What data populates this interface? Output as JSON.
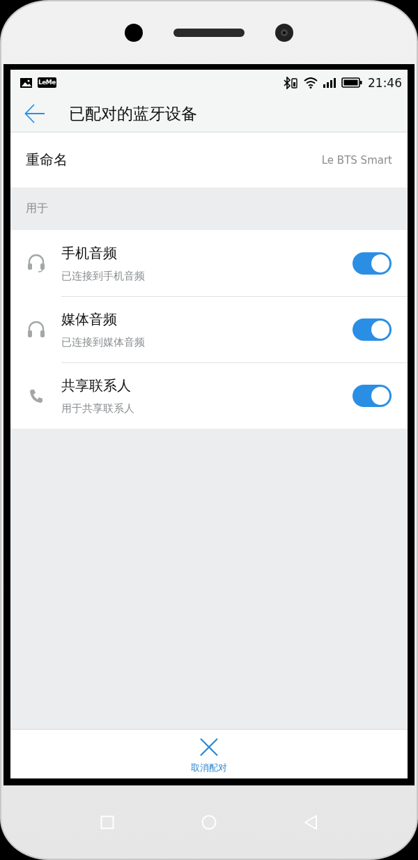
{
  "status_bar": {
    "app_badge": "LeMe",
    "time": "21:46"
  },
  "app_bar": {
    "title": "已配对的蓝牙设备"
  },
  "rename": {
    "label": "重命名",
    "value": "Le BTS Smart"
  },
  "section": {
    "title": "用于"
  },
  "profiles": [
    {
      "kind": "headset",
      "title": "手机音频",
      "subtitle": "已连接到手机音频",
      "on": true
    },
    {
      "kind": "headphones",
      "title": "媒体音频",
      "subtitle": "已连接到媒体音频",
      "on": true
    },
    {
      "kind": "phone",
      "title": "共享联系人",
      "subtitle": "用于共享联系人",
      "on": true
    }
  ],
  "bottom_action": {
    "label": "取消配对"
  }
}
